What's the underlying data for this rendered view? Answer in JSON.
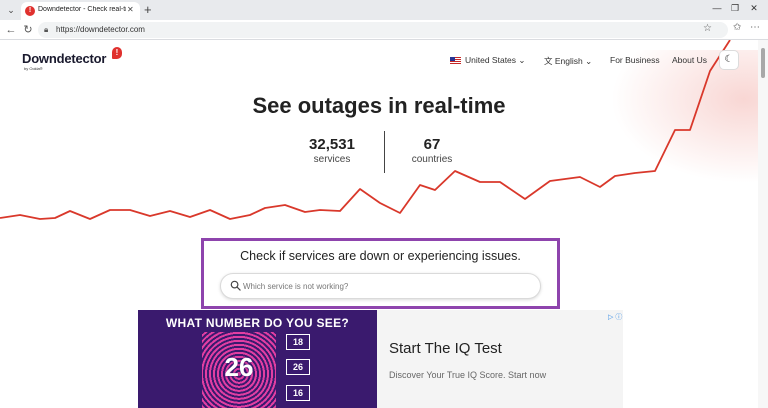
{
  "browser": {
    "tab_title": "Downdetector - Check real-time o",
    "url": "https://downdetector.com"
  },
  "header": {
    "logo_text": "Downdetector",
    "logo_sub": "by Ookla®",
    "country": "United States",
    "language": "English",
    "for_business": "For Business",
    "about_us": "About Us"
  },
  "hero": {
    "title": "See outages in real-time",
    "services_value": "32,531",
    "services_label": "services",
    "countries_value": "67",
    "countries_label": "countries"
  },
  "search": {
    "heading": "Check if services are down or experiencing issues.",
    "placeholder": "Which service is not working?"
  },
  "ad": {
    "question": "WHAT NUMBER DO YOU SEE?",
    "shown_number": "26",
    "options": [
      "18",
      "26",
      "16"
    ],
    "title": "Start The IQ Test",
    "description": "Discover Your True IQ Score. Start now"
  },
  "colors": {
    "accent": "#e0312e",
    "line": "#d9382b",
    "highlight": "#8e44ad"
  }
}
